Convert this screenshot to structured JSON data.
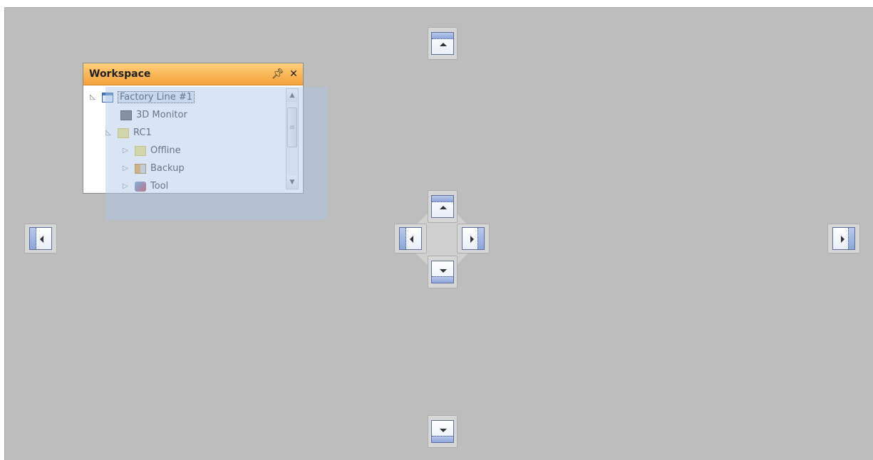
{
  "workspace": {
    "title": "Workspace",
    "pin_icon": "pin-icon",
    "close_icon": "close-icon",
    "tree": [
      {
        "label": "Factory Line #1",
        "icon": "window-icon",
        "expanded": true,
        "selected": true
      },
      {
        "label": "3D Monitor",
        "icon": "monitor-icon"
      },
      {
        "label": "RC1",
        "icon": "controller-icon",
        "expanded": true
      },
      {
        "label": "Offline",
        "icon": "controller-icon",
        "expanded": false
      },
      {
        "label": "Backup",
        "icon": "backup-icon",
        "expanded": false
      },
      {
        "label": "Tool",
        "icon": "tool-icon",
        "expanded": false
      }
    ]
  },
  "dock_guides": {
    "outer": [
      "dock-top",
      "dock-bottom",
      "dock-left",
      "dock-right"
    ],
    "center": [
      "dock-center-top",
      "dock-center-bottom",
      "dock-center-left",
      "dock-center-right"
    ]
  },
  "colors": {
    "background": "#bdbdbd",
    "panel_header": "#f4a13a",
    "guide_accent": "#8ea6dc"
  }
}
